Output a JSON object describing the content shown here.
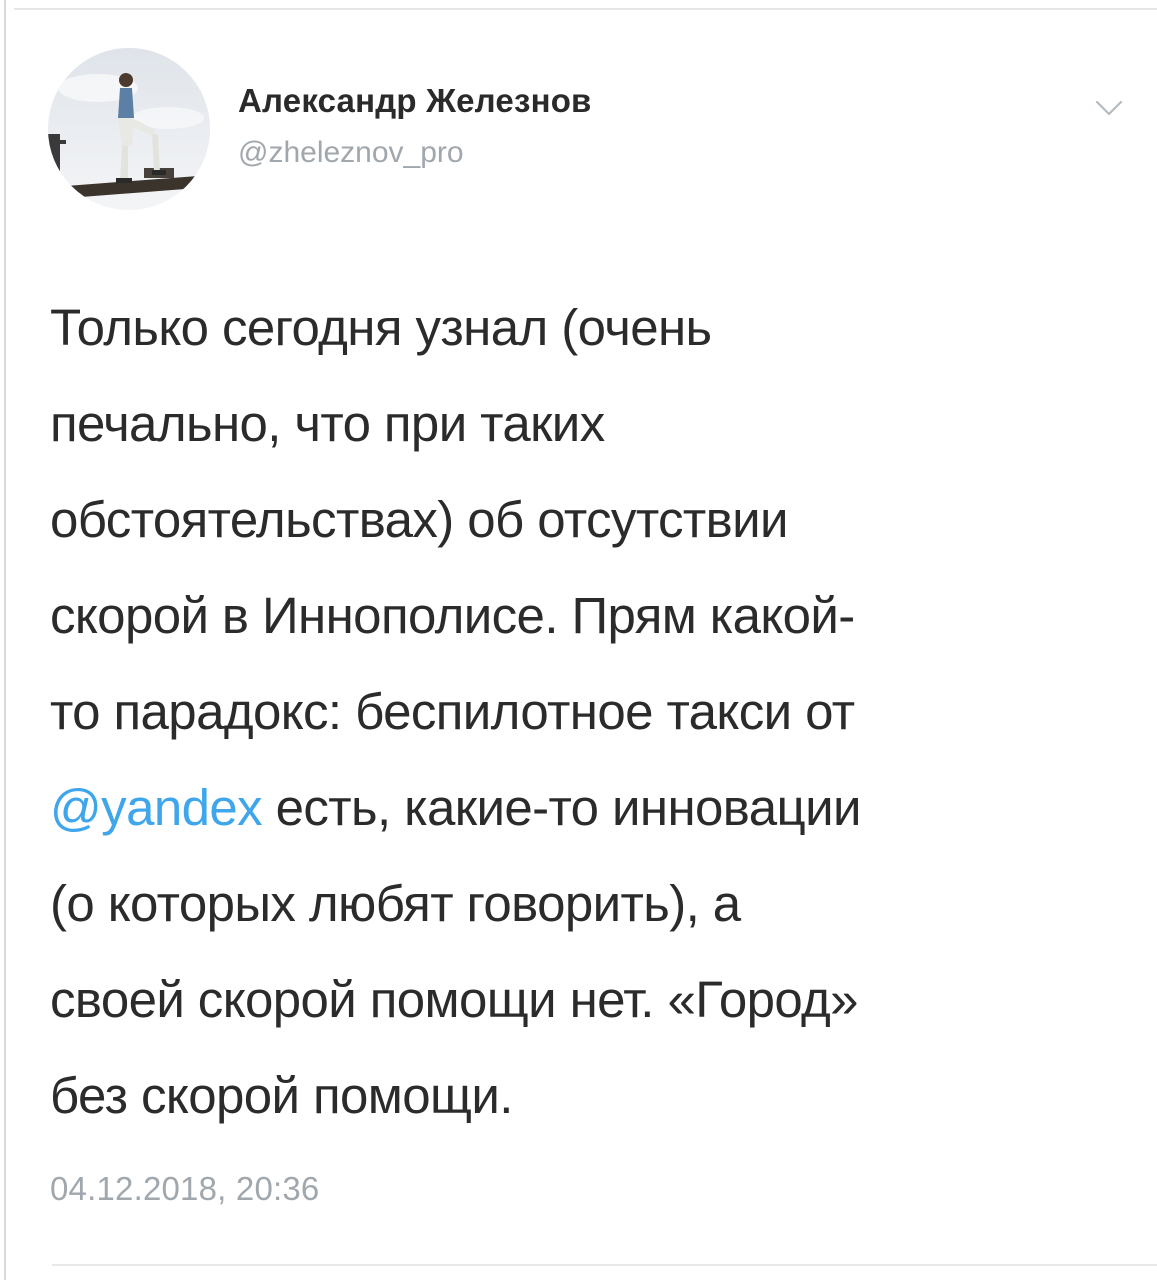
{
  "tweet": {
    "author": {
      "name": "Александр Железнов",
      "handle": "@zheleznov_pro",
      "avatar_icon": "user-avatar-photo"
    },
    "menu_icon": "chevron-down-icon",
    "lines": [
      {
        "text": "Только сегодня узнал (очень"
      },
      {
        "text": "печально, что при таких"
      },
      {
        "text": "обстоятельствах) об отсутствии"
      },
      {
        "text": "скорой в Иннополисе. Прям какой-"
      },
      {
        "text": "то парадокс: беспилотное такси от"
      },
      {
        "mention": "@yandex",
        "text": " есть, какие-то инновации"
      },
      {
        "text": "(о которых любят говорить), а"
      },
      {
        "text": "своей скорой помощи нет. «Город»"
      },
      {
        "text": "без скорой помощи."
      }
    ],
    "timestamp": "04.12.2018, 20:36"
  },
  "colors": {
    "text": "#2b2b2b",
    "muted": "#a0a7ad",
    "link": "#3fa6ec",
    "background": "#ffffff"
  }
}
